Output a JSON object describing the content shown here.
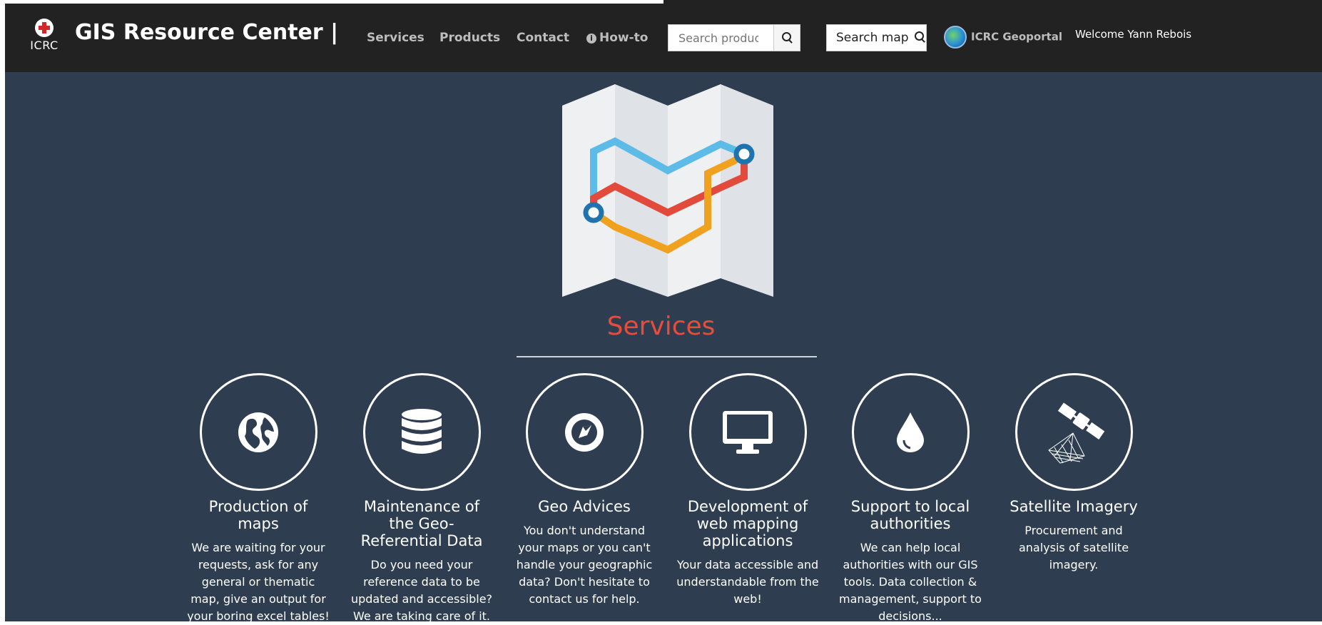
{
  "header": {
    "logo_text": "ICRC",
    "brand": "GIS Resource Center |",
    "nav": {
      "services": "Services",
      "products": "Products",
      "contact": "Contact",
      "howto": "How-to"
    },
    "search": {
      "placeholder": "Search product"
    },
    "search_map_label": "Search map",
    "geoportal_label": "ICRC Geoportal",
    "welcome": "Welcome Yann Rebois"
  },
  "main": {
    "title": "Services",
    "services": [
      {
        "icon": "globe-icon",
        "title": "Production of maps",
        "desc": "We are waiting for your requests, ask for any general or thematic map, give an output for your boring excel tables!"
      },
      {
        "icon": "database-icon",
        "title": "Maintenance of the Geo-Referential Data",
        "desc": "Do you need your reference data to be updated and accessible? We are taking care of it."
      },
      {
        "icon": "compass-icon",
        "title": "Geo Advices",
        "desc": "You don't understand your maps or you can't handle your geographic data? Don't hesitate to contact us for help."
      },
      {
        "icon": "monitor-icon",
        "title": "Development of web mapping applications",
        "desc": "Your data accessible and understandable from the web!"
      },
      {
        "icon": "drop-icon",
        "title": "Support to local authorities",
        "desc": "We can help local authorities with our GIS tools. Data collection & management, support to decisions..."
      },
      {
        "icon": "satellite-icon",
        "title": "Satellite Imagery",
        "desc": "Procurement and analysis of satellite imagery."
      }
    ]
  },
  "colors": {
    "navbar": "#222222",
    "background": "#2e3e50",
    "accent": "#e74c3c",
    "route_blue": "#5dbbe8",
    "route_red": "#e24a3b",
    "route_orange": "#f0a21f"
  }
}
